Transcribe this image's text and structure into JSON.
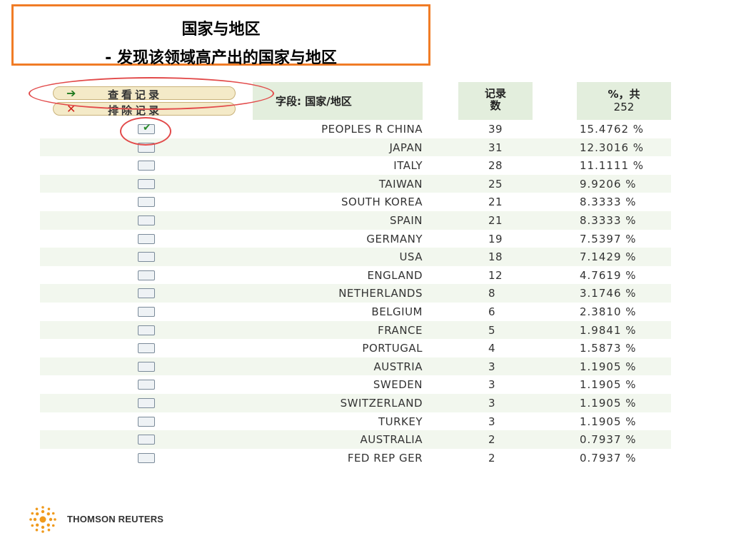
{
  "title": {
    "line1": "国家与地区",
    "line2": "- 发现该领域高产出的国家与地区"
  },
  "buttons": {
    "view_records": "查看记录",
    "exclude_records": "排除记录"
  },
  "table": {
    "headers": {
      "field": "字段: 国家/地区",
      "count_line1": "记录",
      "count_line2": "数",
      "pct_line1": "%，共",
      "pct_line2": "252"
    },
    "rows": [
      {
        "country": "PEOPLES R CHINA",
        "count": "39",
        "pct": "15.4762 %",
        "checked": true
      },
      {
        "country": "JAPAN",
        "count": "31",
        "pct": "12.3016 %",
        "checked": false
      },
      {
        "country": "ITALY",
        "count": "28",
        "pct": "11.1111 %",
        "checked": false
      },
      {
        "country": "TAIWAN",
        "count": "25",
        "pct": "9.9206 %",
        "checked": false
      },
      {
        "country": "SOUTH KOREA",
        "count": "21",
        "pct": "8.3333 %",
        "checked": false
      },
      {
        "country": "SPAIN",
        "count": "21",
        "pct": "8.3333 %",
        "checked": false
      },
      {
        "country": "GERMANY",
        "count": "19",
        "pct": "7.5397 %",
        "checked": false
      },
      {
        "country": "USA",
        "count": "18",
        "pct": "7.1429 %",
        "checked": false
      },
      {
        "country": "ENGLAND",
        "count": "12",
        "pct": "4.7619 %",
        "checked": false
      },
      {
        "country": "NETHERLANDS",
        "count": "8",
        "pct": "3.1746 %",
        "checked": false
      },
      {
        "country": "BELGIUM",
        "count": "6",
        "pct": "2.3810 %",
        "checked": false
      },
      {
        "country": "FRANCE",
        "count": "5",
        "pct": "1.9841 %",
        "checked": false
      },
      {
        "country": "PORTUGAL",
        "count": "4",
        "pct": "1.5873 %",
        "checked": false
      },
      {
        "country": "AUSTRIA",
        "count": "3",
        "pct": "1.1905 %",
        "checked": false
      },
      {
        "country": "SWEDEN",
        "count": "3",
        "pct": "1.1905 %",
        "checked": false
      },
      {
        "country": "SWITZERLAND",
        "count": "3",
        "pct": "1.1905 %",
        "checked": false
      },
      {
        "country": "TURKEY",
        "count": "3",
        "pct": "1.1905 %",
        "checked": false
      },
      {
        "country": "AUSTRALIA",
        "count": "2",
        "pct": "0.7937 %",
        "checked": false
      },
      {
        "country": "FED REP GER",
        "count": "2",
        "pct": "0.7937 %",
        "checked": false
      }
    ]
  },
  "icons": {
    "view": "arrow-right-icon",
    "exclude": "x-icon",
    "checked": "checkmark-icon"
  },
  "colors": {
    "title_border": "#f07c26",
    "annotation": "#e24a4a",
    "header_bg": "#e3eedd",
    "alt_row_bg": "#f2f7ee"
  },
  "logo": {
    "text": "THOMSON REUTERS"
  }
}
